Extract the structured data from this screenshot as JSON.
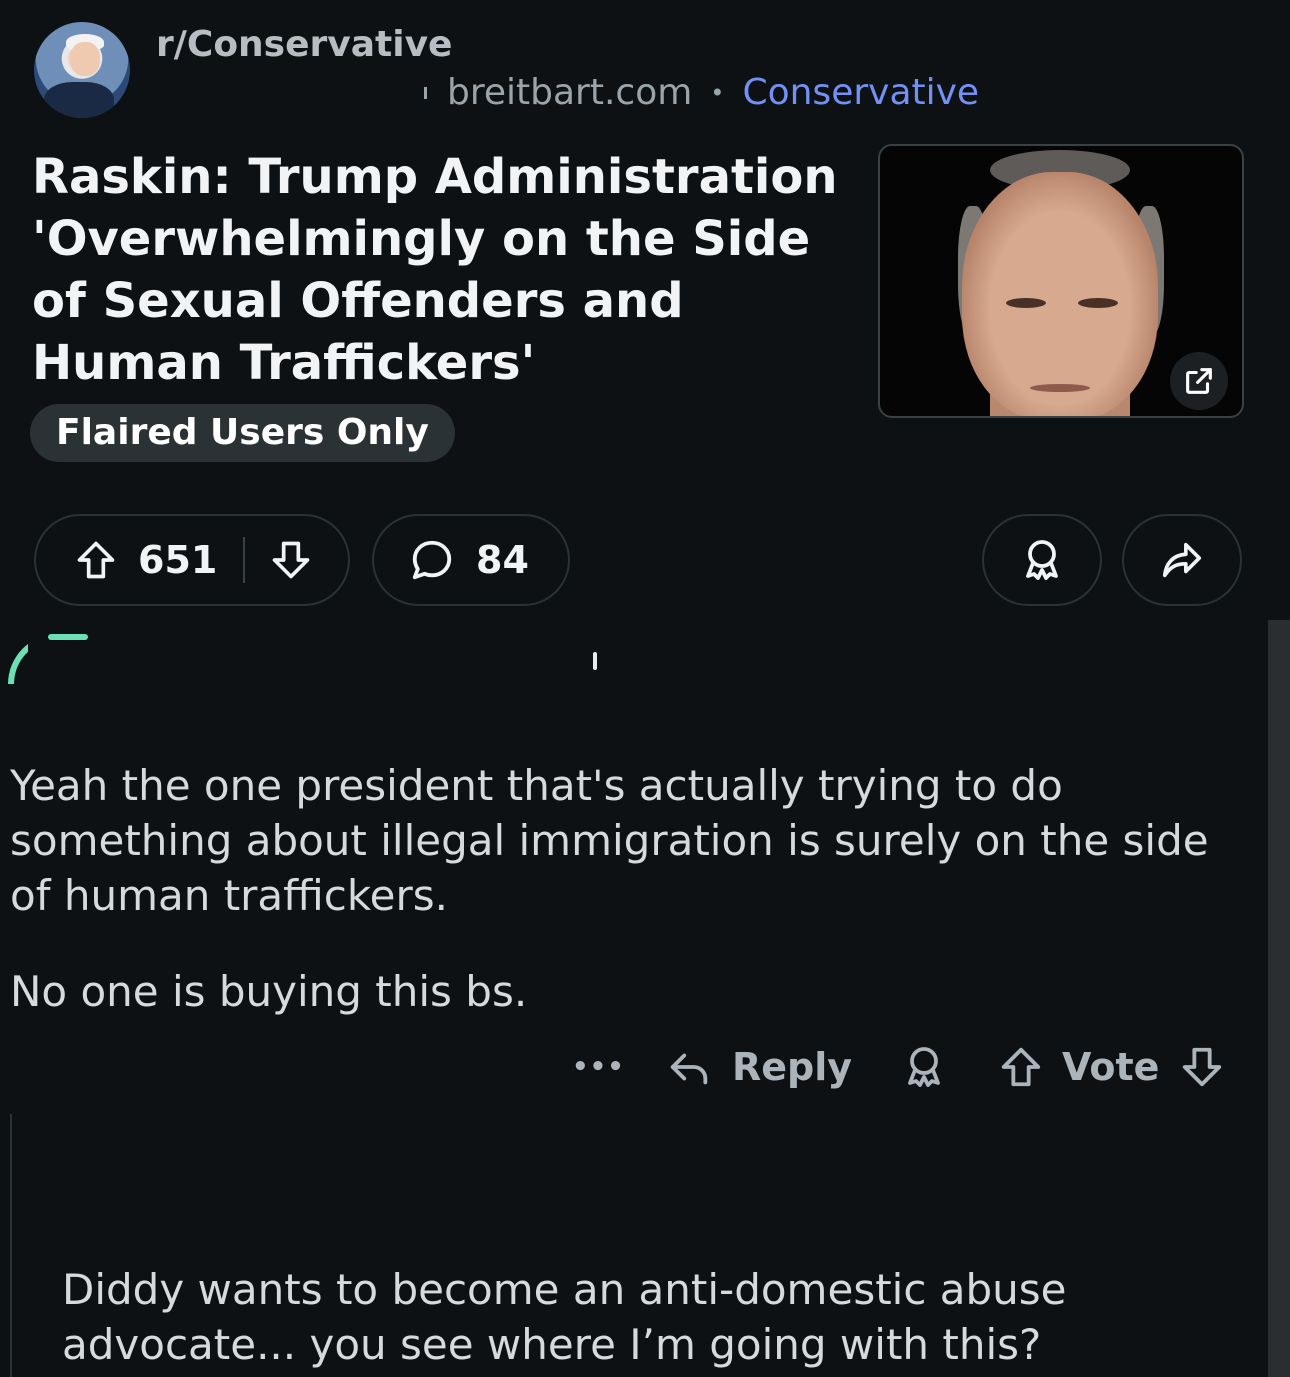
{
  "post": {
    "subreddit": "r/Conservative",
    "domain": "breitbart.com",
    "separator": "•",
    "community_flair": "Conservative",
    "title": "Raskin: Trump Administration 'Overwhelmingly on the Side of Sexual Offenders and Human Traffickers'",
    "post_flair": "Flaired Users Only",
    "upvotes": "651",
    "comments": "84"
  },
  "comments": [
    {
      "paragraphs": [
        "Yeah the one president that's actually trying to do something about illegal immigration is surely on the side of human traffickers.",
        "No one is buying this bs."
      ],
      "more_label": "•••",
      "reply_label": "Reply",
      "vote_label": "Vote"
    },
    {
      "paragraphs": [
        "Diddy wants to become an anti-domestic abuse advocate... you see where I’m going with this?"
      ]
    }
  ],
  "icons": {
    "avatar": "subreddit-avatar",
    "external": "external-link-icon",
    "upvote": "upvote-arrow-icon",
    "downvote": "downvote-arrow-icon",
    "comment": "comment-bubble-icon",
    "award": "award-icon",
    "share": "share-icon",
    "reply": "reply-arrow-icon",
    "more": "more-options-icon"
  },
  "colors": {
    "background": "#0e1113",
    "flair_link": "#7390f5",
    "pill_border": "#2b3236",
    "flair_pill": "#2b3236",
    "comment_avatar": "#6be0b4"
  }
}
